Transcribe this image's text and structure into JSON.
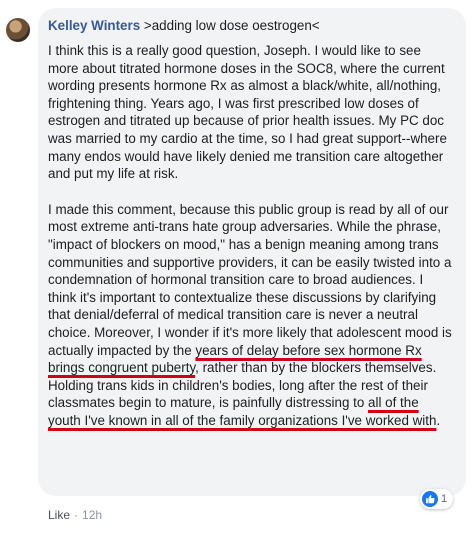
{
  "comment": {
    "author": "Kelley Winters",
    "quote_text": ">adding low dose oestrogen<",
    "paragraph1": "I think this is a really good question, Joseph. I would like to see more about titrated hormone doses in the SOC8, where the current wording presents hormone Rx as almost a black/white, all/nothing, frightening thing. Years ago, I was first prescribed low doses of estrogen and titrated up because of prior health issues. My PC doc was married to my cardio at the time, so I had great support--where many endos would have likely denied me transition care altogether and put my life at risk.",
    "paragraph2": {
      "part1": "I made this comment, because this public group is read by all of our most extreme anti-trans hate group adversaries. While the phrase, \"impact of blockers on mood,\" has a benign meaning among trans communities and supportive providers, it can be easily twisted into a condemnation of hormonal transition care to broad audiences. I think it's important to contextualize these discussions by clarifying that denial/deferral of medical transition care is never a neutral choice. Moreover, I wonder if it's more likely that adolescent mood is actually impacted by the ",
      "underline1": "years of delay before sex hormone Rx brings congruent puberty",
      "part2": ", rather than by the blockers themselves. Holding trans kids in children's bodies, long after the rest of their classmates begin to mature, is painfully distressing to ",
      "underline2": "all of the youth I've known in all of the family organizations I've worked with",
      "part3": "."
    }
  },
  "footer": {
    "like_label": "Like",
    "separator": "·",
    "timestamp": "12h"
  },
  "reactions": {
    "count": "1",
    "icon": "thumbs-up-icon",
    "color": "#1877f2"
  },
  "colors": {
    "underline": "#d0021b",
    "author_link": "#385898"
  }
}
